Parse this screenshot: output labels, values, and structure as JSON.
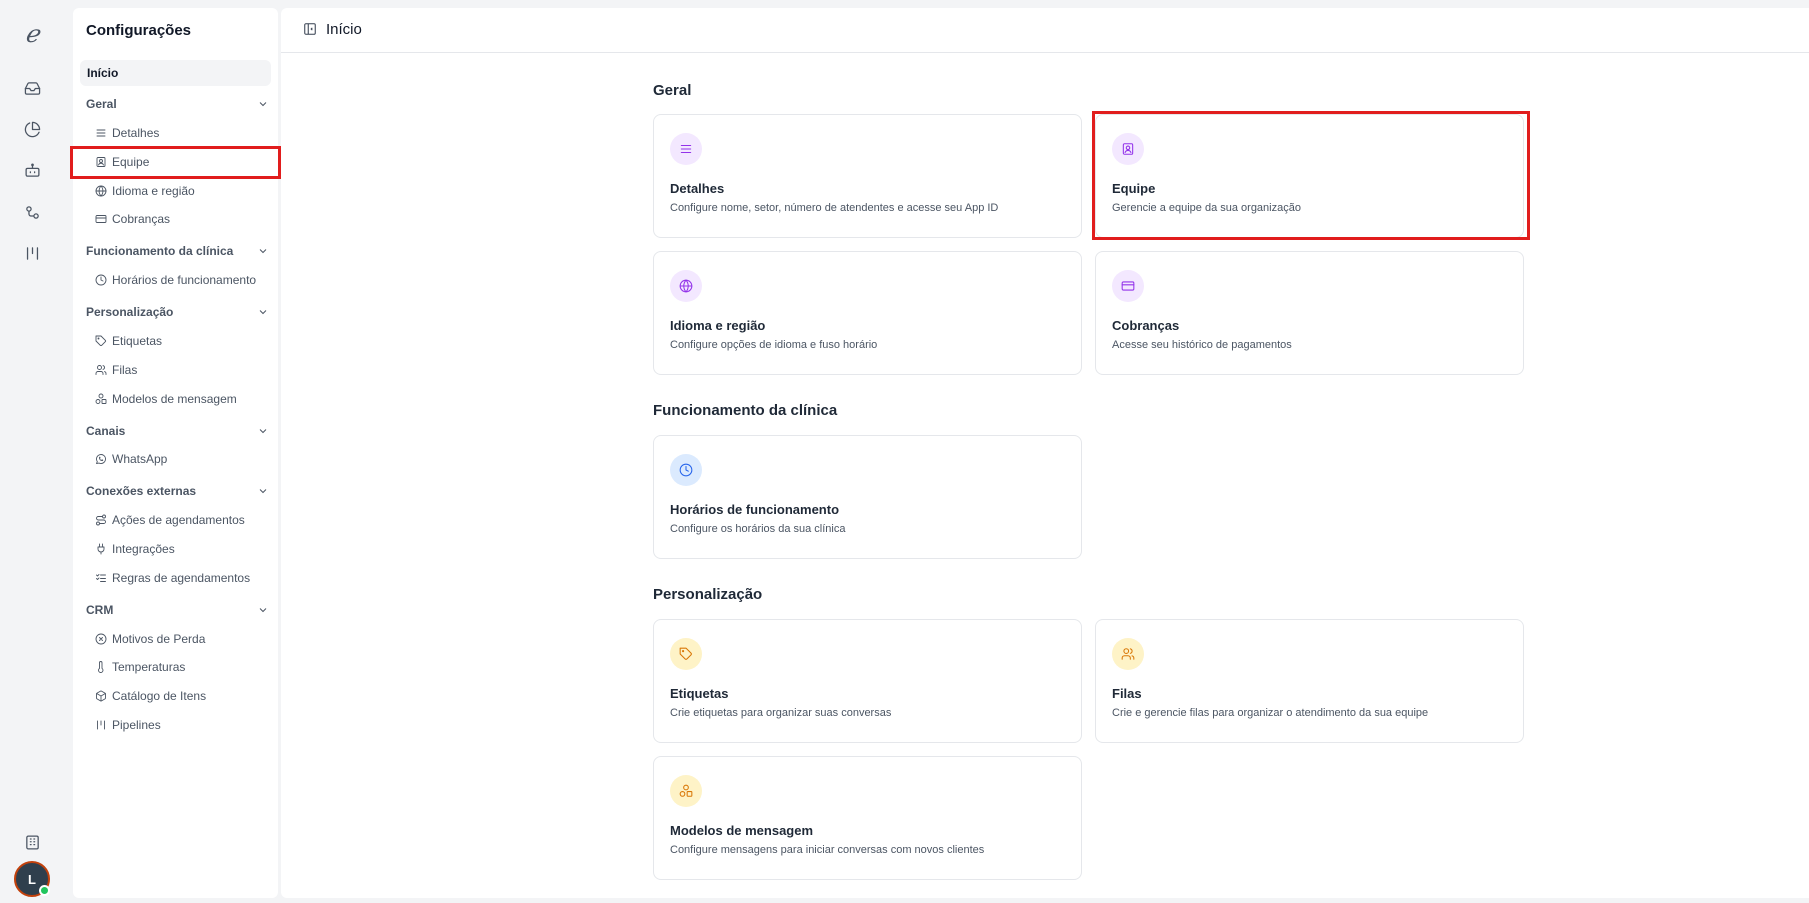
{
  "rail": {
    "logo": "ℯ",
    "icons": [
      "inbox-icon",
      "chart-pie-icon",
      "bot-icon",
      "connections-icon",
      "pipeline-icon",
      "building-icon"
    ],
    "avatar_initial": "L"
  },
  "sidebar": {
    "title": "Configurações",
    "home": "Início",
    "groups": [
      {
        "label": "Geral",
        "items": [
          "Detalhes",
          "Equipe",
          "Idioma e região",
          "Cobranças"
        ]
      },
      {
        "label": "Funcionamento da clínica",
        "items": [
          "Horários de funcionamento"
        ]
      },
      {
        "label": "Personalização",
        "items": [
          "Etiquetas",
          "Filas",
          "Modelos de mensagem"
        ]
      },
      {
        "label": "Canais",
        "items": [
          "WhatsApp"
        ]
      },
      {
        "label": "Conexões externas",
        "items": [
          "Ações de agendamentos",
          "Integrações",
          "Regras de agendamentos"
        ]
      },
      {
        "label": "CRM",
        "items": [
          "Motivos de Perda",
          "Temperaturas",
          "Catálogo de Itens",
          "Pipelines"
        ]
      }
    ]
  },
  "header": {
    "title": "Início"
  },
  "main": {
    "sections": [
      {
        "title": "Geral",
        "cards": [
          {
            "title": "Detalhes",
            "description": "Configure nome, setor, número de atendentes e acesse seu App ID",
            "icon": "list-icon",
            "color": "#9333ea"
          },
          {
            "title": "Equipe",
            "description": "Gerencie a equipe da sua organização",
            "icon": "id-badge-icon",
            "color": "#9333ea"
          },
          {
            "title": "Idioma e região",
            "description": "Configure opções de idioma e fuso horário",
            "icon": "globe-icon",
            "color": "#9333ea"
          },
          {
            "title": "Cobranças",
            "description": "Acesse seu histórico de pagamentos",
            "icon": "credit-card-icon",
            "color": "#9333ea"
          }
        ]
      },
      {
        "title": "Funcionamento da clínica",
        "cards": [
          {
            "title": "Horários de funcionamento",
            "description": "Configure os horários da sua clínica",
            "icon": "clock-icon",
            "color": "#2563eb"
          }
        ]
      },
      {
        "title": "Personalização",
        "cards": [
          {
            "title": "Etiquetas",
            "description": "Crie etiquetas para organizar suas conversas",
            "icon": "tag-icon",
            "color": "#d97706"
          },
          {
            "title": "Filas",
            "description": "Crie e gerencie filas para organizar o atendimento da sua equipe",
            "icon": "users-icon",
            "color": "#d97706"
          },
          {
            "title": "Modelos de mensagem",
            "description": "Configure mensagens para iniciar conversas com novos clientes",
            "icon": "shapes-icon",
            "color": "#d97706"
          }
        ]
      }
    ]
  },
  "colors": {
    "highlight": "#e11d1d",
    "purple": "#9333ea",
    "blue": "#2563eb",
    "yellow": "#d97706"
  }
}
